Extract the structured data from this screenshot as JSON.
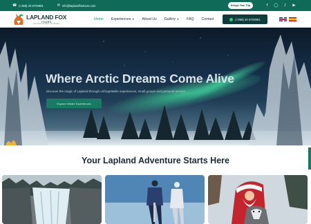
{
  "topbar": {
    "phone": "(+358) 40 6703991",
    "email": "info@laplandfoxtours.com",
    "cta": "Design Your Trip",
    "socials": [
      "facebook-icon",
      "instagram-icon",
      "tiktok-icon",
      "youtube-icon"
    ]
  },
  "brand": {
    "name": "LAPLAND FOX",
    "tours": "TOURS",
    "tagline": "DISCOVER THE MAGIC OF LAPLAND"
  },
  "nav": {
    "items": [
      {
        "label": "Home",
        "active": true,
        "dropdown": false
      },
      {
        "label": "Experiences",
        "active": false,
        "dropdown": true
      },
      {
        "label": "About Us",
        "active": false,
        "dropdown": false
      },
      {
        "label": "Gallery",
        "active": false,
        "dropdown": true
      },
      {
        "label": "FAQ",
        "active": false,
        "dropdown": false
      },
      {
        "label": "Contact",
        "active": false,
        "dropdown": false
      }
    ],
    "phone_button": "(+358) 40 6703991",
    "languages": [
      "English",
      "Español"
    ]
  },
  "hero": {
    "title": "Where Arctic Dreams Come Alive",
    "subtitle": "Discover the magic of Lapland through unforgettable experiences, small groups and personal service.",
    "button": "Explore Winter Experiences"
  },
  "section": {
    "title": "Your Lapland Adventure Starts Here"
  },
  "colors": {
    "brand_green": "#0f6b58",
    "accent_green": "#1a9a6c",
    "dark_button": "#0e3b3c"
  }
}
